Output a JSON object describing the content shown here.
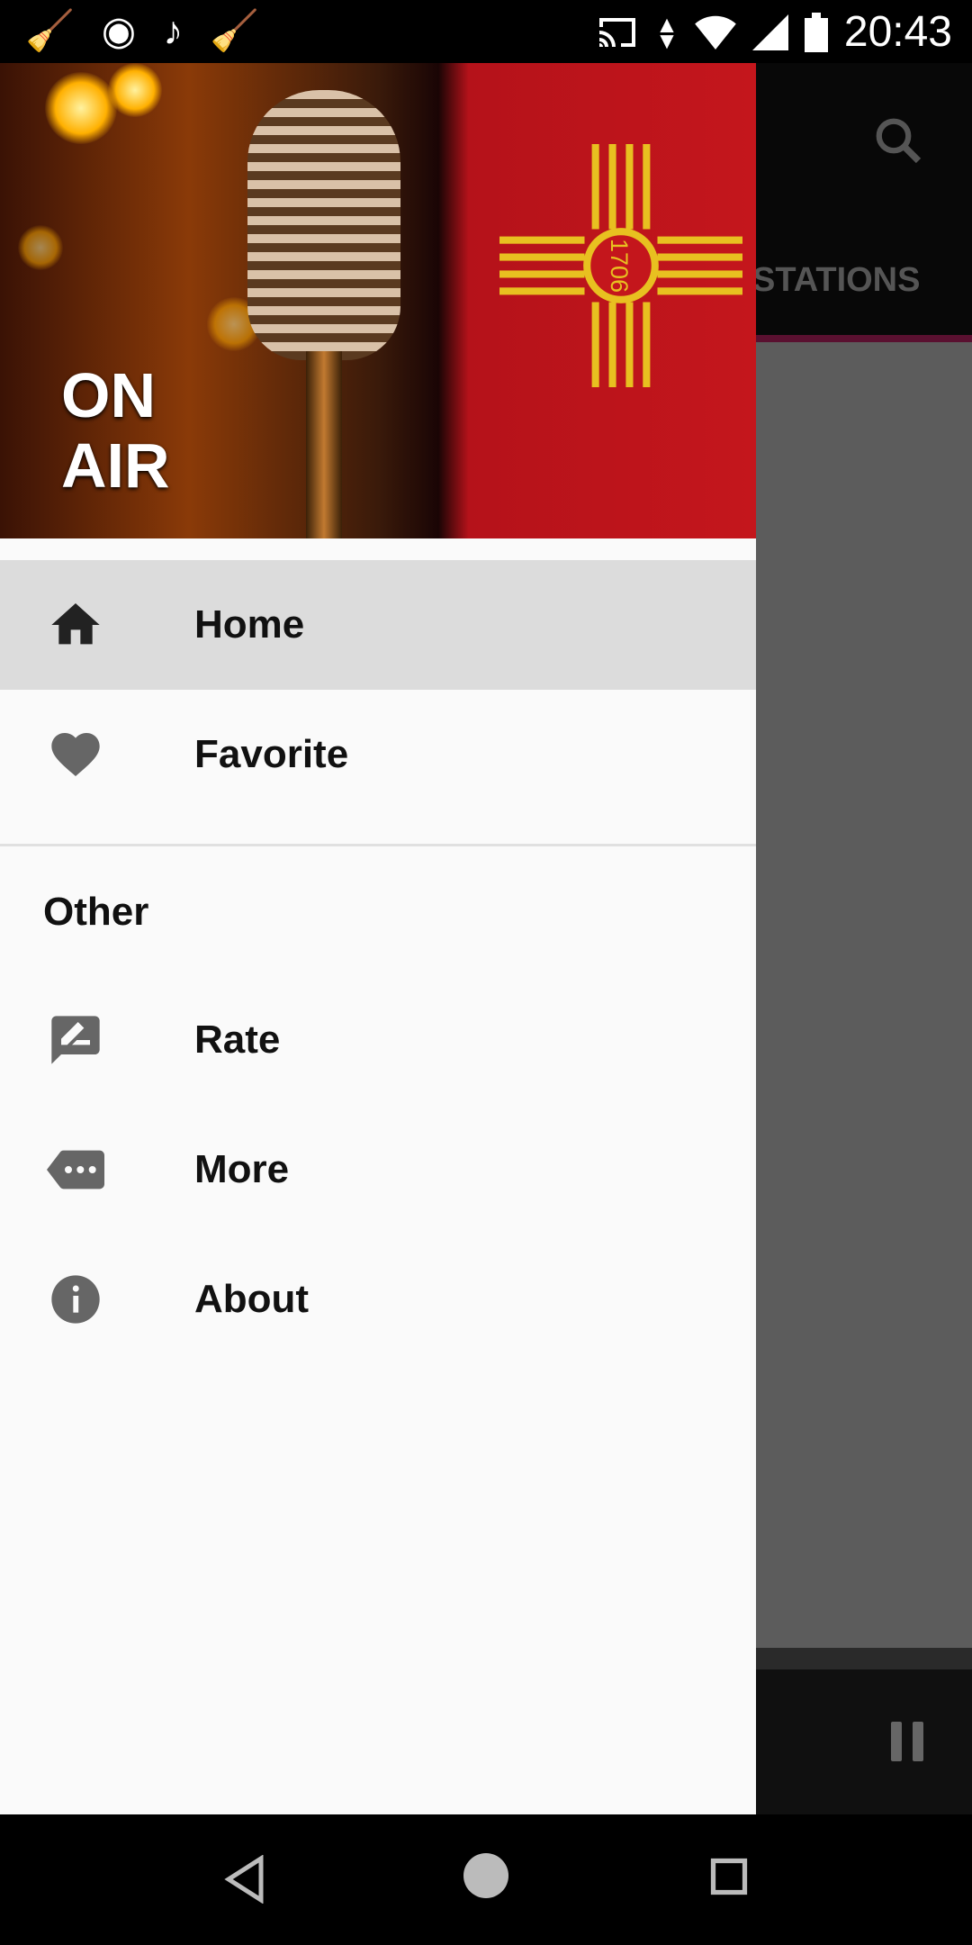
{
  "status_bar": {
    "time": "20:43",
    "left_icons": [
      "cleaner-icon",
      "aperture-icon",
      "music-note-icon",
      "cleaner-icon"
    ],
    "right_icons": [
      "cast-icon",
      "data-arrows-icon",
      "wifi-icon",
      "signal-icon",
      "battery-icon"
    ]
  },
  "header_image": {
    "text": "ON AIR",
    "flag_text": "1706"
  },
  "drawer": {
    "items": [
      {
        "label": "Home",
        "icon": "home-icon",
        "selected": true
      },
      {
        "label": "Favorite",
        "icon": "heart-icon"
      }
    ],
    "section_title": "Other",
    "other_items": [
      {
        "label": "Rate",
        "icon": "rate-review-icon"
      },
      {
        "label": "More",
        "icon": "more-tag-icon"
      },
      {
        "label": "About",
        "icon": "info-icon"
      }
    ]
  },
  "background_app": {
    "tab_label": "STATIONS",
    "accent": "#5a1030"
  },
  "colors": {
    "drawer_bg": "#fafafa",
    "selected_bg": "#dcdcdc",
    "icon": "#555555"
  }
}
